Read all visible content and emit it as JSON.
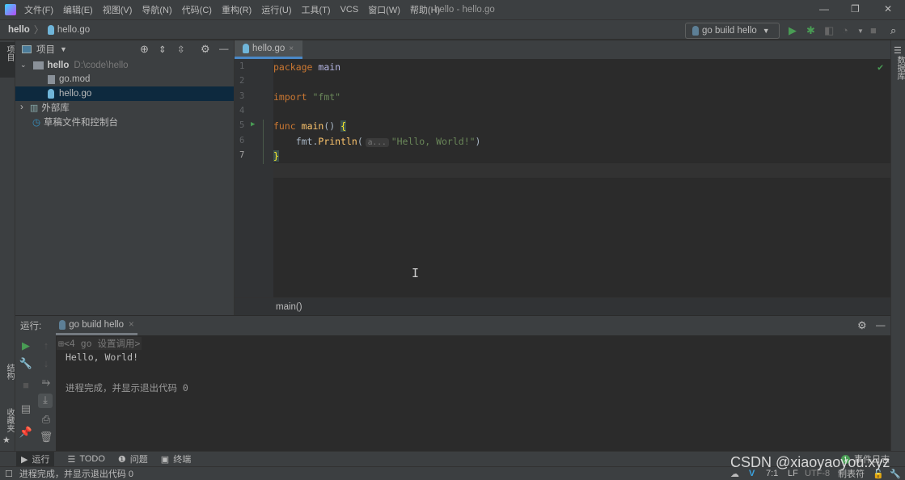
{
  "menu": [
    "文件(F)",
    "编辑(E)",
    "视图(V)",
    "导航(N)",
    "代码(C)",
    "重构(R)",
    "运行(U)",
    "工具(T)",
    "VCS",
    "窗口(W)",
    "帮助(H)"
  ],
  "window_title": "hello - hello.go",
  "breadcrumb": {
    "project": "hello",
    "file": "hello.go"
  },
  "run_config": "go build hello",
  "left_strip": {
    "project": "项目",
    "structure": "结构",
    "favorites": "收藏夹"
  },
  "right_strip": {
    "database": "数据库"
  },
  "project_panel": {
    "title": "项目",
    "root": "hello",
    "root_path": "D:\\code\\hello",
    "files": [
      "go.mod",
      "hello.go"
    ],
    "external": "外部库",
    "scratches": "草稿文件和控制台"
  },
  "editor": {
    "tab": "hello.go",
    "line_numbers": [
      "1",
      "2",
      "3",
      "4",
      "5",
      "6",
      "7"
    ],
    "lines": {
      "l1a": "package",
      "l1b": "main",
      "l3a": "import",
      "l3b": "\"fmt\"",
      "l5a": "func",
      "l5b": "main",
      "l5c": "() ",
      "l5d": "{",
      "l6a": "    fmt.",
      "l6b": "Println",
      "l6c": "(",
      "l6hint": "a...",
      "l6d": "\"Hello, World!\"",
      "l6e": ")",
      "l7": "}"
    },
    "breadcrumb": "main()"
  },
  "run_panel": {
    "label": "运行:",
    "tab": "go build hello",
    "console": [
      "<4 go 设置调用>",
      "Hello, World!",
      "进程完成，并显示退出代码 0"
    ]
  },
  "bottom_tabs": [
    "运行",
    "TODO",
    "问题",
    "终端"
  ],
  "status": {
    "message": "进程完成，并显示退出代码 0",
    "event_log": "事件日志",
    "event_count": "1",
    "position": "7:1",
    "line_sep": "LF",
    "encoding": "UTF-8",
    "indent": "制表符"
  },
  "watermark": "CSDN @xiaoyaoyou.xyz",
  "colors": {
    "accent": "#4a88c7",
    "run_green": "#499c54",
    "selection": "#0d293e"
  }
}
